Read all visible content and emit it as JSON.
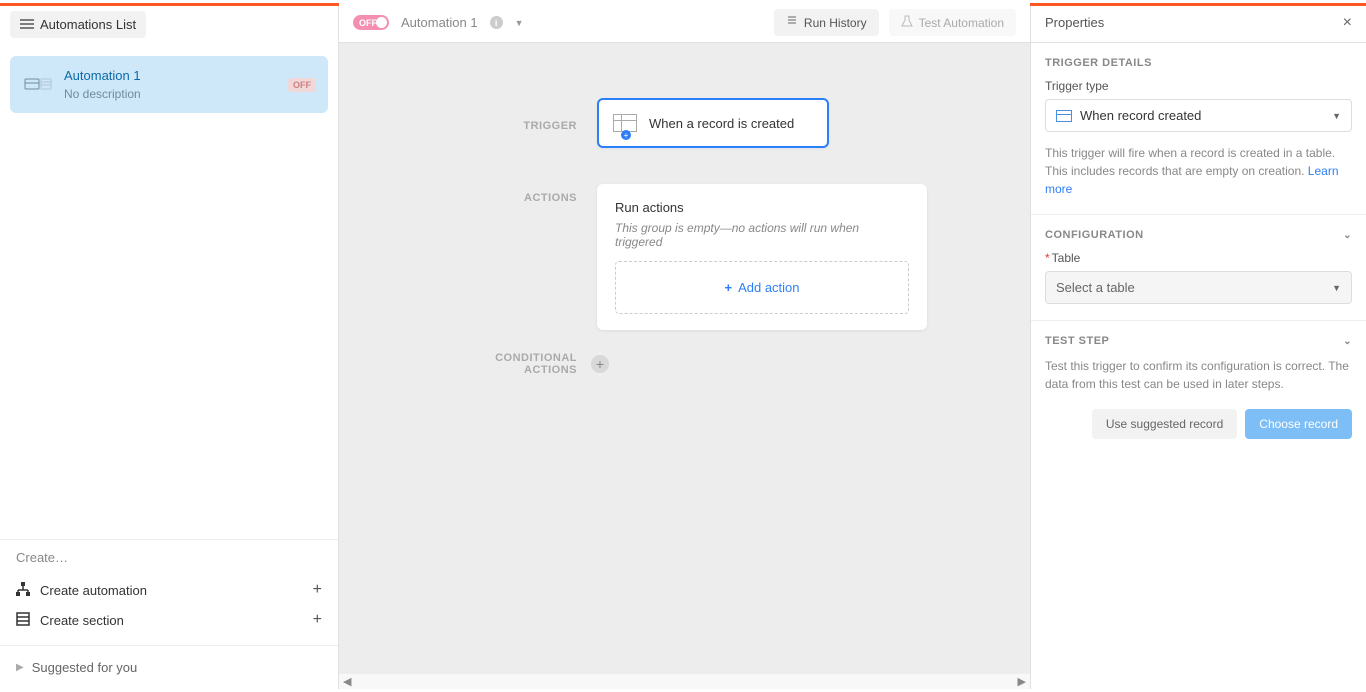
{
  "sidebar": {
    "title": "Automations List",
    "items": [
      {
        "title": "Automation 1",
        "desc": "No description",
        "badge": "OFF"
      }
    ],
    "create_label": "Create…",
    "create_automation": "Create automation",
    "create_section": "Create section",
    "suggested": "Suggested for you"
  },
  "canvas": {
    "toggle": "OFF",
    "title": "Automation 1",
    "run_history": "Run History",
    "test_automation": "Test Automation",
    "labels": {
      "trigger": "TRIGGER",
      "actions": "ACTIONS",
      "conditional": "CONDITIONAL ACTIONS"
    },
    "trigger_card": "When a record is created",
    "actions_card": {
      "title": "Run actions",
      "desc": "This group is empty—no actions will run when triggered",
      "add": "Add action"
    }
  },
  "properties": {
    "title": "Properties",
    "trigger_details": "TRIGGER DETAILS",
    "trigger_type_label": "Trigger type",
    "trigger_type_value": "When record created",
    "trigger_help": "This trigger will fire when a record is created in a table. This includes records that are empty on creation. ",
    "learn_more": "Learn more",
    "configuration": "CONFIGURATION",
    "table_label": "Table",
    "table_placeholder": "Select a table",
    "test_step": "TEST STEP",
    "test_help": "Test this trigger to confirm its configuration is correct. The data from this test can be used in later steps.",
    "use_suggested": "Use suggested record",
    "choose_record": "Choose record"
  }
}
